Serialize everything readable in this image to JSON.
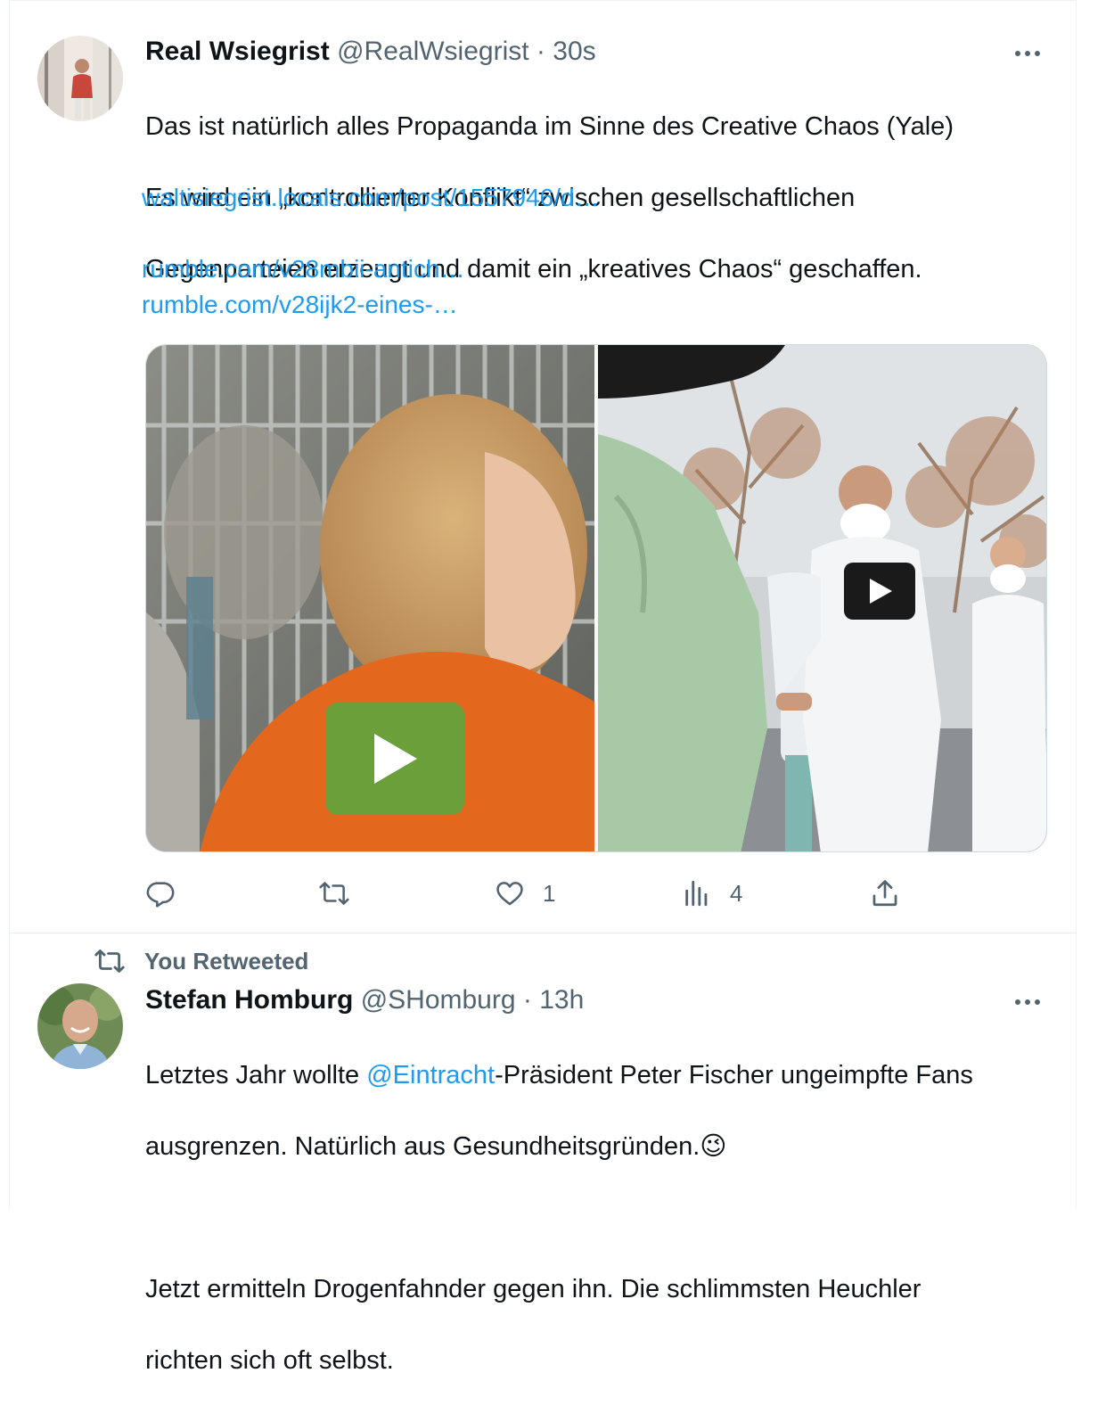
{
  "tweet1": {
    "display_name": "Real Wsiegrist",
    "handle": "@RealWsiegrist",
    "separator": "·",
    "time": "30s",
    "text_lines": [
      "Das ist natürlich alles Propaganda im Sinne des Creative Chaos (Yale)",
      "Es wird ein „kontrollierter Konflikt“ zwischen gesellschaftlichen",
      "Gegenparteien erzeugt und damit ein „kreatives Chaos“ geschaffen."
    ],
    "links": [
      "waltisiegrist.locals.com/post/1557946/d…",
      "rumble.com/v28mbii-antich…",
      "rumble.com/v28ijk2-eines-…"
    ],
    "media": [
      {
        "kind": "video",
        "play_button_color": "#6a9f3a"
      },
      {
        "kind": "video",
        "play_button_color": "#1a1a1a"
      }
    ],
    "actions": {
      "reply_count": "",
      "retweet_count": "",
      "like_count": "1",
      "views_count": "4"
    }
  },
  "retweet_banner": {
    "label": "You Retweeted"
  },
  "tweet2": {
    "display_name": "Stefan Homburg",
    "handle": "@SHomburg",
    "separator": "·",
    "time": "13h",
    "line1_before": "Letztes Jahr wollte ",
    "mention": "@Eintracht",
    "line1_after": "-Präsident Peter Fischer ungeimpfte Fans",
    "line2": "ausgrenzen. Natürlich aus Gesundheitsgründen.",
    "emoji": "😉",
    "para2_lines": [
      "Jetzt ermitteln Drogenfahnder gegen ihn. Die schlimmsten Heuchler",
      "richten sich oft selbst."
    ]
  },
  "colors": {
    "link": "#1d9bf0",
    "secondary_text": "#536471",
    "primary_text": "#0f1419"
  },
  "icons": [
    "more-icon",
    "reply-icon",
    "retweet-icon",
    "like-icon",
    "views-icon",
    "share-icon",
    "play-icon"
  ]
}
